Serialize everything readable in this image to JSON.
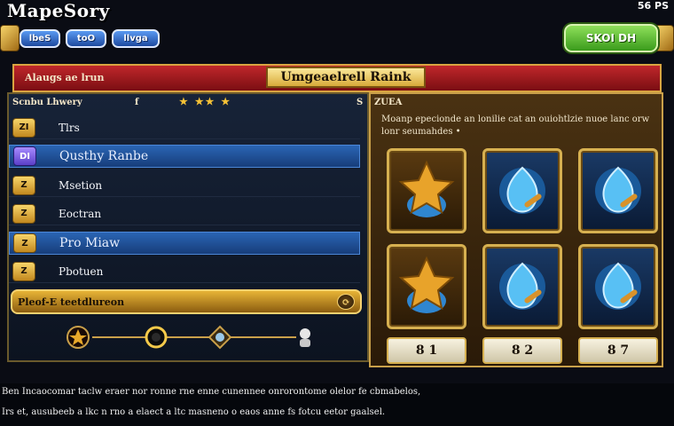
{
  "app": {
    "title": "MapeSory",
    "corner": "56 PS"
  },
  "tabs": [
    {
      "label": "lbeS"
    },
    {
      "label": "toO"
    },
    {
      "label": "llvga"
    }
  ],
  "confirm": {
    "label": "SKOI DH"
  },
  "header": {
    "left": "Alaugs ae lrun",
    "plaque": "Umgeaelrell Raink"
  },
  "left": {
    "subheader": "Scnbu Lhwery",
    "chip": "f",
    "stars": "★ ★★ ★",
    "end": "S",
    "rows": [
      {
        "badge": "ZI",
        "label": "Tlrs"
      },
      {
        "badge": "DI",
        "label": "Qusthy Ranbe"
      },
      {
        "badge": "Z",
        "label": "Msetion"
      },
      {
        "badge": "Z",
        "label": "Eoctran"
      },
      {
        "badge": "Z",
        "label": "Pro Miaw"
      },
      {
        "badge": "Z",
        "label": "Pbotuen"
      }
    ],
    "bonus": "Pleof-E teetdlureon",
    "bonus_arrow": "⟳"
  },
  "right": {
    "tag": "ZUEA",
    "description": "Moanp epecionde an lonilie cat an ouiohtlzie nuoe lanc orw lonr seumahdes •",
    "counts": [
      "8 1",
      "8 2",
      "8 7"
    ]
  },
  "footer": {
    "line1": "Ben Incaocomar taclw eraer nor ronne rne enne cunennee onrorontome olelor fe cbmabelos,",
    "line2": "Irs et, ausubeeb a lkc n rno a elaect a ltc masneno o eaos anne fs fotcu eetor gaalsel."
  },
  "colors": {
    "accent_red": "#c0272b",
    "gold": "#d9a441",
    "blue_selected": "#2a65b4",
    "green_button": "#3a9b1c"
  }
}
